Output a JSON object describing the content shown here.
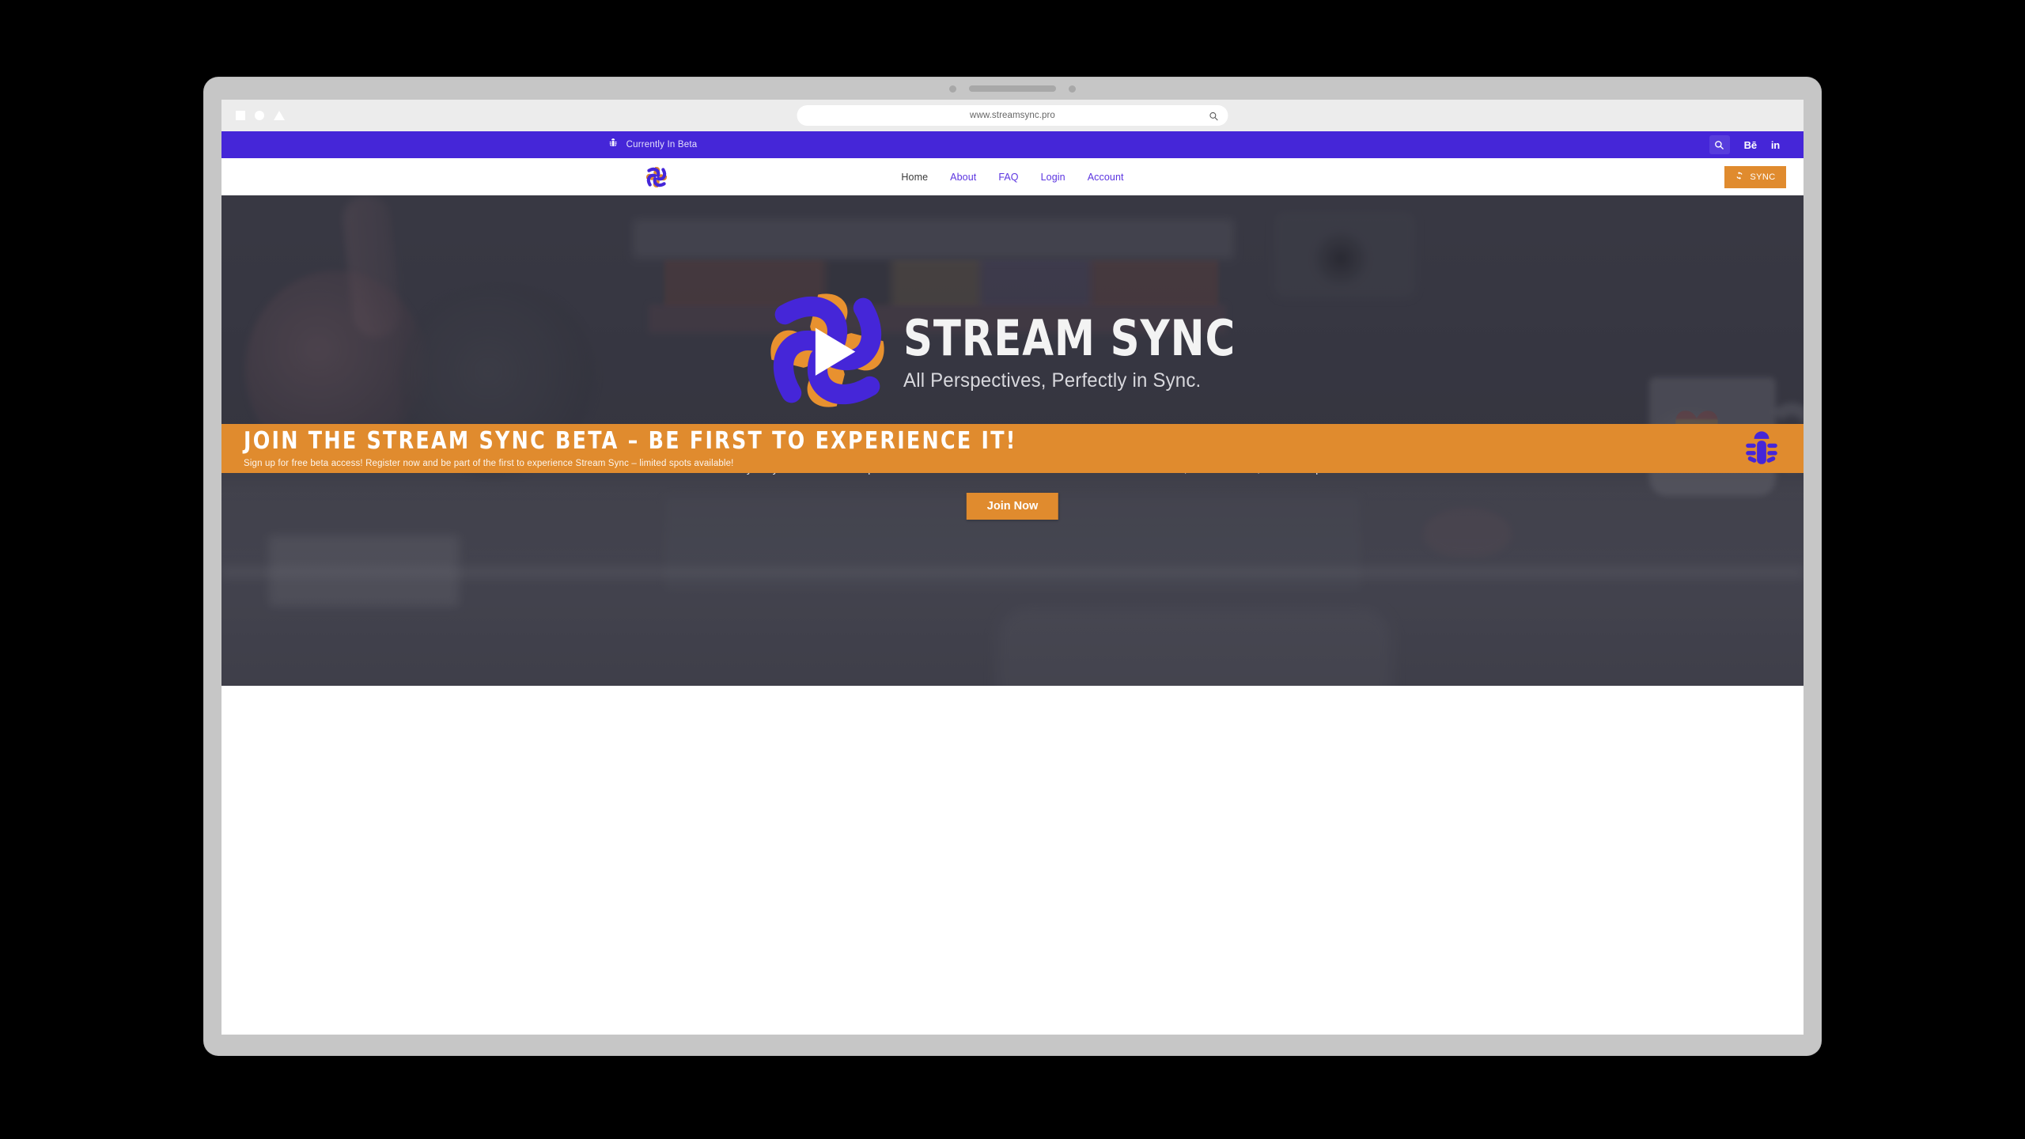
{
  "browser": {
    "window_controls": [
      "square-icon",
      "circle-icon",
      "triangle-icon"
    ],
    "url": "www.streamsync.pro",
    "url_search_icon": "search-icon"
  },
  "announcement": {
    "icon": "bug-icon",
    "text": "Currently In Beta",
    "actions": [
      {
        "name": "search",
        "icon": "search-icon",
        "label": ""
      },
      {
        "name": "behance",
        "icon": "behance-icon",
        "label": "Bē"
      },
      {
        "name": "linkedin",
        "icon": "linkedin-icon",
        "label": "in"
      }
    ],
    "background": "#4526d8"
  },
  "navbar": {
    "logo": "stream-sync-pinwheel-logo",
    "links": [
      {
        "label": "Home",
        "active": true
      },
      {
        "label": "About",
        "active": false
      },
      {
        "label": "FAQ",
        "active": false
      },
      {
        "label": "Login",
        "active": false
      },
      {
        "label": "Account",
        "active": false
      }
    ],
    "cta": {
      "label": "SYNC",
      "icon": "sync-refresh-icon",
      "background": "#e08b2e"
    }
  },
  "hero": {
    "logo": "stream-sync-pinwheel-play-logo",
    "title": "STREAM SYNC",
    "tagline": "All Perspectives, Perfectly in Sync.",
    "description": "The easiest way to sync and watch multiple video streams from different sources. Perfect for online events, collaborations, and watch parties.",
    "background_image": "desk-with-pink-headphones-books-webcam-and-rainbow-heart-mug"
  },
  "beta_banner": {
    "headline": "JOIN THE STREAM SYNC BETA – BE FIRST TO EXPERIENCE IT!",
    "subtext": "Sign up for free beta access! Register now and be part of the first to experience Stream Sync – limited spots available!",
    "icon": "bug-icon",
    "background": "#e08b2e",
    "icon_color": "#4526d8"
  },
  "join_cta": {
    "label": "Join Now",
    "background": "#e08b2e"
  },
  "colors": {
    "brand_purple": "#4526d8",
    "brand_orange": "#e08b2e",
    "nav_link": "#5b34e0",
    "nav_link_active": "#3a3a3a"
  }
}
